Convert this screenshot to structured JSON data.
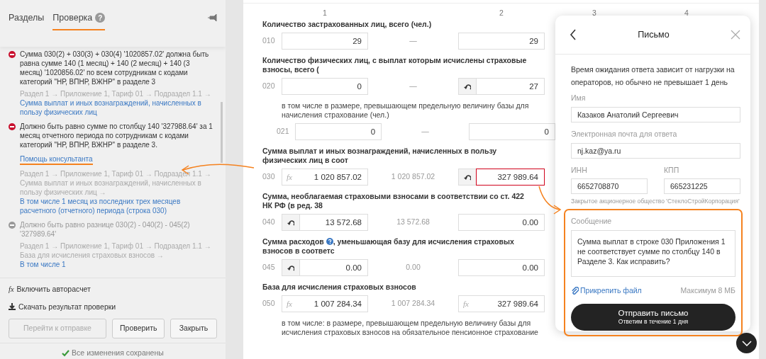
{
  "sidebar": {
    "tabs": [
      {
        "label": "Разделы",
        "selected": false
      },
      {
        "label": "Проверка",
        "selected": true,
        "badge": "?"
      }
    ],
    "errors": [
      {
        "kind": "error",
        "message": "Сумма 030(2) + 030(3) + 030(4) '1020857.02' должна быть равна сумме 140 (1 месяц) + 140 (2 месяц) + 140 (3 месяц) '1020856.02' по всем сотрудникам с кодами категорий \"НР, ВПНР, ВЖНР\" в разделе 3",
        "path": "Раздел 1 → Приложение 1, Тариф 01 → Подраздел 1.1 →",
        "link": "Сумма выплат и иных вознаграждений, начисленных в пользу физических лиц"
      },
      {
        "kind": "error",
        "message": "Должно быть равно сумме по столбцу 140 '327988.64' за 1  месяц отчетного периода по сотрудникам с кодами  категорий \"НР, ВПНР, ВЖНР\" в разделе 3.",
        "help": {
          "label": "Помощь консультанта",
          "highlighted": true
        },
        "path": "Раздел 1 → Приложение 1, Тариф 01 → Подраздел 1.1 → Сумма выплат и иных вознаграждений, начисленных в пользу физических лиц →",
        "link": "В том числе 1 месяц из последних трех месяцев расчетного (отчетного) периода (строка 030)"
      },
      {
        "kind": "resolved",
        "message": "Должно быть равно разнице 030(2) - 040(2) - 045(2) '327989.64'",
        "path": "Раздел 1 → Приложение 1, Тариф 01 → Подраздел 1.1 → База для исчисления страховых взносов →",
        "link": "В том числе 1"
      }
    ],
    "autocalc": {
      "glyph": "fx",
      "label": "Включить авторасчет"
    },
    "download": {
      "label": "Скачать результат проверки"
    },
    "buttons": [
      {
        "label": "Перейти к отправке",
        "disabled": true
      },
      {
        "label": "Проверить",
        "disabled": false
      },
      {
        "label": "Закрыть",
        "disabled": false
      }
    ],
    "status": "Все изменения сохранены"
  },
  "form": {
    "columns": [
      "1",
      "2",
      "3",
      "4"
    ],
    "blocks": [
      {
        "kind": "heading",
        "text": "Количество застрахованных лиц, всего (чел.)",
        "code": "010",
        "col1": {
          "kind": "plain",
          "value": "29"
        },
        "mid": "—",
        "col2": {
          "kind": "plain",
          "value": "29",
          "error": false
        }
      },
      {
        "kind": "heading",
        "text": "Количество физических лиц, с выплат которым исчислены страховые взносы, всего (",
        "code": "020",
        "col1": {
          "kind": "plain",
          "value": "0"
        },
        "mid": "—",
        "col2": {
          "kind": "undo",
          "value": "27",
          "error": false
        }
      },
      {
        "kind": "sub",
        "text": "в том числе в размере, превышающем предельную величину базы для начисления страхование (чел.)",
        "code": "021",
        "col1": {
          "kind": "plain",
          "value": "0"
        },
        "mid": "—",
        "col2": {
          "kind": "plain",
          "value": "0",
          "error": false
        }
      },
      {
        "kind": "heading",
        "text": "Сумма выплат и иных вознаграждений, начисленных в пользу физических лиц в соот",
        "code": "030",
        "col1": {
          "kind": "formula",
          "glyph": "fx",
          "value": "1 020 857.02"
        },
        "mid": "1 020 857.02",
        "col2": {
          "kind": "undo",
          "value": "327 989.64",
          "error": true
        }
      },
      {
        "kind": "heading",
        "text": "Сумма, необлагаемая страховыми взносами в соответствии со ст. 422 НК РФ (в ред. 38",
        "code": "040",
        "col1": {
          "kind": "undo",
          "value": "13 572.68"
        },
        "mid": "13 572.68",
        "col2": {
          "kind": "plain",
          "value": "0.00",
          "error": false
        }
      },
      {
        "kind": "heading",
        "text": "Сумма расходов",
        "help": true,
        "text_after": ", уменьшающая базу для исчисления страховых взносов в соответс",
        "code": "045",
        "col1": {
          "kind": "undo",
          "value": "0.00"
        },
        "mid": "0.00",
        "col2": {
          "kind": "plain",
          "value": "0.00",
          "error": false
        }
      },
      {
        "kind": "heading",
        "text": "База для исчисления страховых взносов",
        "code": "050",
        "col1": {
          "kind": "formula",
          "glyph": "fx",
          "value": "1 007 284.34"
        },
        "mid": "1 007 284.34",
        "col2": {
          "kind": "formula",
          "glyph": "fx",
          "value": "327 989.64",
          "error": false
        }
      },
      {
        "kind": "note",
        "text": "в том числе: в размере, превышающем предельную величину базы для исчисления страховых взносов на обязательное пенсионное страхование"
      }
    ]
  },
  "letter": {
    "title": "Письмо",
    "intro": "Время ожидания ответа зависит от нагрузки на операторов, но обычно не превышает 1 день",
    "name": {
      "label": "Имя",
      "value": "Казаков Анатолий Сергеевич"
    },
    "email": {
      "label": "Электронная почта для ответа",
      "value": "nj.kaz@ya.ru"
    },
    "inn": {
      "label": "ИНН",
      "value": "6652708870"
    },
    "kpp": {
      "label": "КПП",
      "value": "665231225"
    },
    "company": "Закрытое акционерное общество 'СтеклоСтройКорпорация'",
    "message": {
      "label": "Сообщение",
      "value": "Сумма выплат в строке 030 Приложения 1 не соответствует сумме по столбцу 140 в Разделе 3. Как исправить?",
      "highlighted": true
    },
    "attach": "Прикрепить файл",
    "limit": "Максимум 8 МБ",
    "send": {
      "label": "Отправить письмо",
      "sub": "Ответим в течение 1 дня"
    }
  }
}
